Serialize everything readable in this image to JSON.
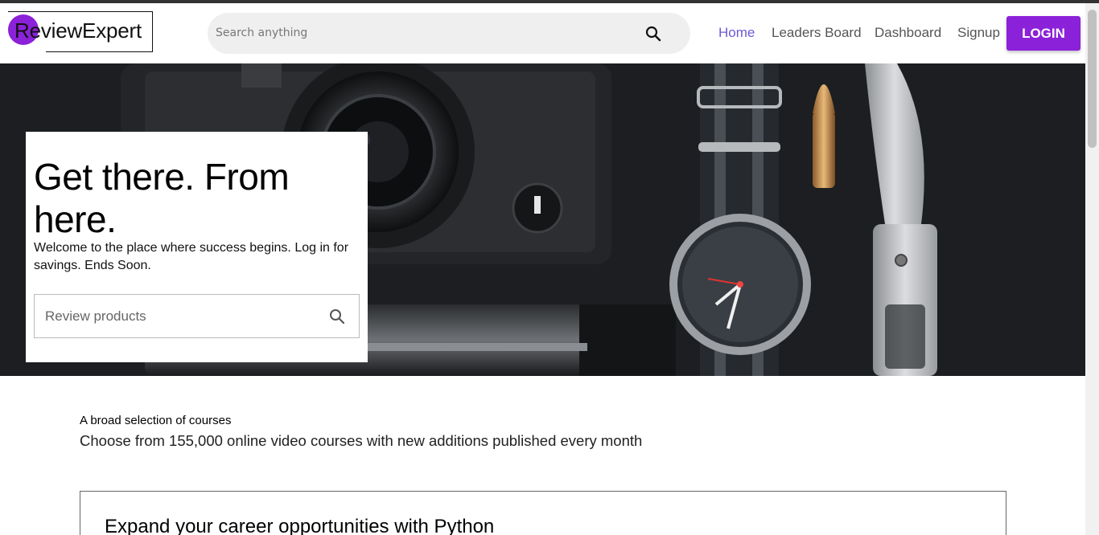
{
  "brand": {
    "name": "ReviewExpert",
    "accent": "#8b21d8"
  },
  "header": {
    "search_placeholder": "Search anything",
    "nav": [
      "Home",
      "Leaders Board",
      "Dashboard",
      "Signup"
    ],
    "active_nav": "Home",
    "login_label": "LOGIN"
  },
  "hero": {
    "title": "Get there. From here.",
    "subtitle": "Welcome to the place where success begins. Log in for savings. Ends Soon.",
    "review_placeholder": "Review products"
  },
  "courses": {
    "kicker": "A broad selection of courses",
    "description": "Choose from 155,000 online video courses with new additions published every month",
    "card_title": "Expand your career opportunities with Python"
  },
  "icons": {
    "search": "search-icon"
  }
}
